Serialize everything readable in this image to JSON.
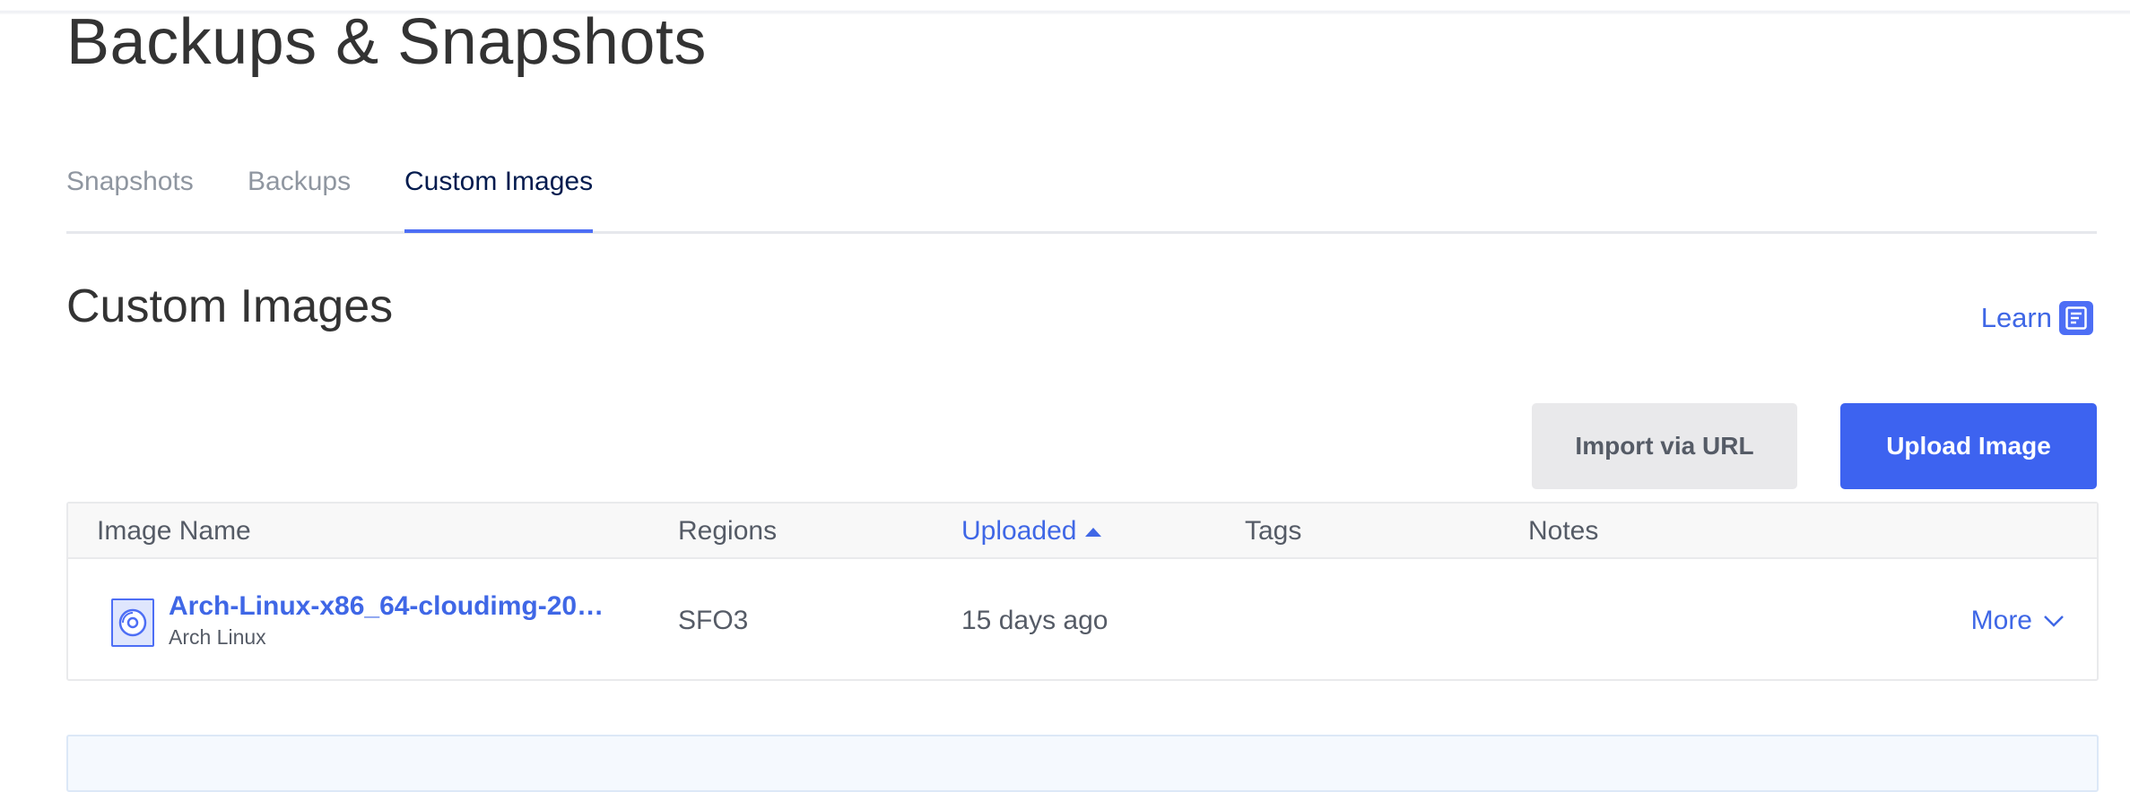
{
  "page": {
    "title": "Backups & Snapshots"
  },
  "tabs": [
    {
      "label": "Snapshots",
      "active": false
    },
    {
      "label": "Backups",
      "active": false
    },
    {
      "label": "Custom Images",
      "active": true
    }
  ],
  "section": {
    "title": "Custom Images",
    "learn_label": "Learn",
    "learn_icon": "document-icon"
  },
  "actions": {
    "import_label": "Import via URL",
    "upload_label": "Upload Image"
  },
  "table": {
    "columns": [
      "Image Name",
      "Regions",
      "Uploaded",
      "Tags",
      "Notes"
    ],
    "sort_column": "Uploaded",
    "sort_direction": "ascending",
    "rows": [
      {
        "name": "Arch-Linux-x86_64-cloudimg-20…",
        "distribution": "Arch Linux",
        "regions": "SFO3",
        "uploaded": "15 days ago",
        "tags": "",
        "notes": "",
        "more_label": "More"
      }
    ]
  },
  "colors": {
    "accent": "#3d63f0",
    "link": "#3f67e6",
    "active_tab_text": "#031b4e"
  }
}
